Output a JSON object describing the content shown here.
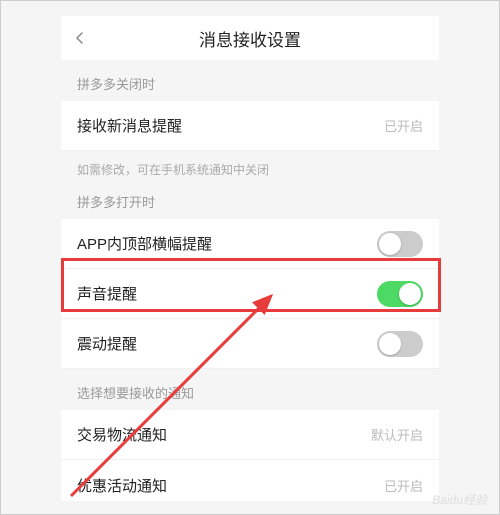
{
  "header": {
    "title": "消息接收设置"
  },
  "sections": {
    "closed_label": "拼多多关闭时",
    "opened_label": "拼多多打开时",
    "select_label": "选择想要接收的通知",
    "hint": "如需修改，可在手机系统通知中关闭"
  },
  "rows": {
    "receive_new": {
      "label": "接收新消息提醒",
      "status": "已开启"
    },
    "banner": {
      "label": "APP内顶部横幅提醒"
    },
    "sound": {
      "label": "声音提醒"
    },
    "vibrate": {
      "label": "震动提醒"
    },
    "logistics": {
      "label": "交易物流通知",
      "status": "默认开启"
    },
    "promo": {
      "label": "优惠活动通知",
      "status": "已开启"
    }
  },
  "watermark": "Baidu经验"
}
